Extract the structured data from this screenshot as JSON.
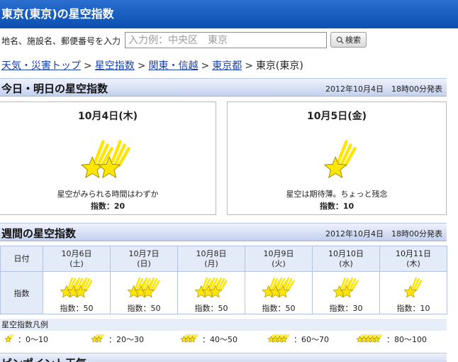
{
  "page": {
    "title": "東京(東京)の星空指数"
  },
  "search": {
    "label": "地名、施設名、郵便番号を入力",
    "placeholder": "入力例：中央区　東京",
    "button_label": "検索"
  },
  "breadcrumb": {
    "links": [
      "天気・災害トップ",
      "星空指数",
      "関東・信越",
      "東京都"
    ],
    "separator": ">",
    "current": "東京(東京)"
  },
  "today": {
    "title": "今日・明日の星空指数",
    "issued": "2012年10月4日　18時00分発表",
    "days": [
      {
        "date": "10月4日(木)",
        "stars": 2,
        "description": "星空がみられる時間はわずか",
        "index_label": "指数：20"
      },
      {
        "date": "10月5日(金)",
        "stars": 1,
        "description": "星空は期待薄。ちょっと残念",
        "index_label": "指数：10"
      }
    ]
  },
  "weekly": {
    "title": "週間の星空指数",
    "issued": "2012年10月4日　18時00分発表",
    "row_header_date": "日付",
    "row_header_index": "指数",
    "days": [
      {
        "date": "10月6日",
        "weekday": "(土)",
        "stars": 3,
        "index_label": "指数：50"
      },
      {
        "date": "10月7日",
        "weekday": "(日)",
        "stars": 3,
        "index_label": "指数：50"
      },
      {
        "date": "10月8日",
        "weekday": "(月)",
        "stars": 3,
        "index_label": "指数：50"
      },
      {
        "date": "10月9日",
        "weekday": "(火)",
        "stars": 3,
        "index_label": "指数：50"
      },
      {
        "date": "10月10日",
        "weekday": "(水)",
        "stars": 2,
        "index_label": "指数：30"
      },
      {
        "date": "10月11日",
        "weekday": "(木)",
        "stars": 1,
        "index_label": "指数：10"
      }
    ]
  },
  "legend": {
    "title": "星空指数凡例",
    "items": [
      {
        "stars": 1,
        "range": "：0～10"
      },
      {
        "stars": 2,
        "range": "：20～30"
      },
      {
        "stars": 3,
        "range": "：40～50"
      },
      {
        "stars": 4,
        "range": "：60～70"
      },
      {
        "stars": 5,
        "range": "：80～100"
      }
    ]
  },
  "bottom_section": {
    "title": "ピンポイント天気"
  },
  "colors": {
    "title_bar": "#0b4fb1",
    "section_bar": "#c4d1ee",
    "star_fill": "#ffe600",
    "star_stroke": "#a08600",
    "link": "#1a3fa8"
  },
  "icons": {
    "search_button": "magnifier-icon",
    "rating": "shooting-star-icon"
  }
}
